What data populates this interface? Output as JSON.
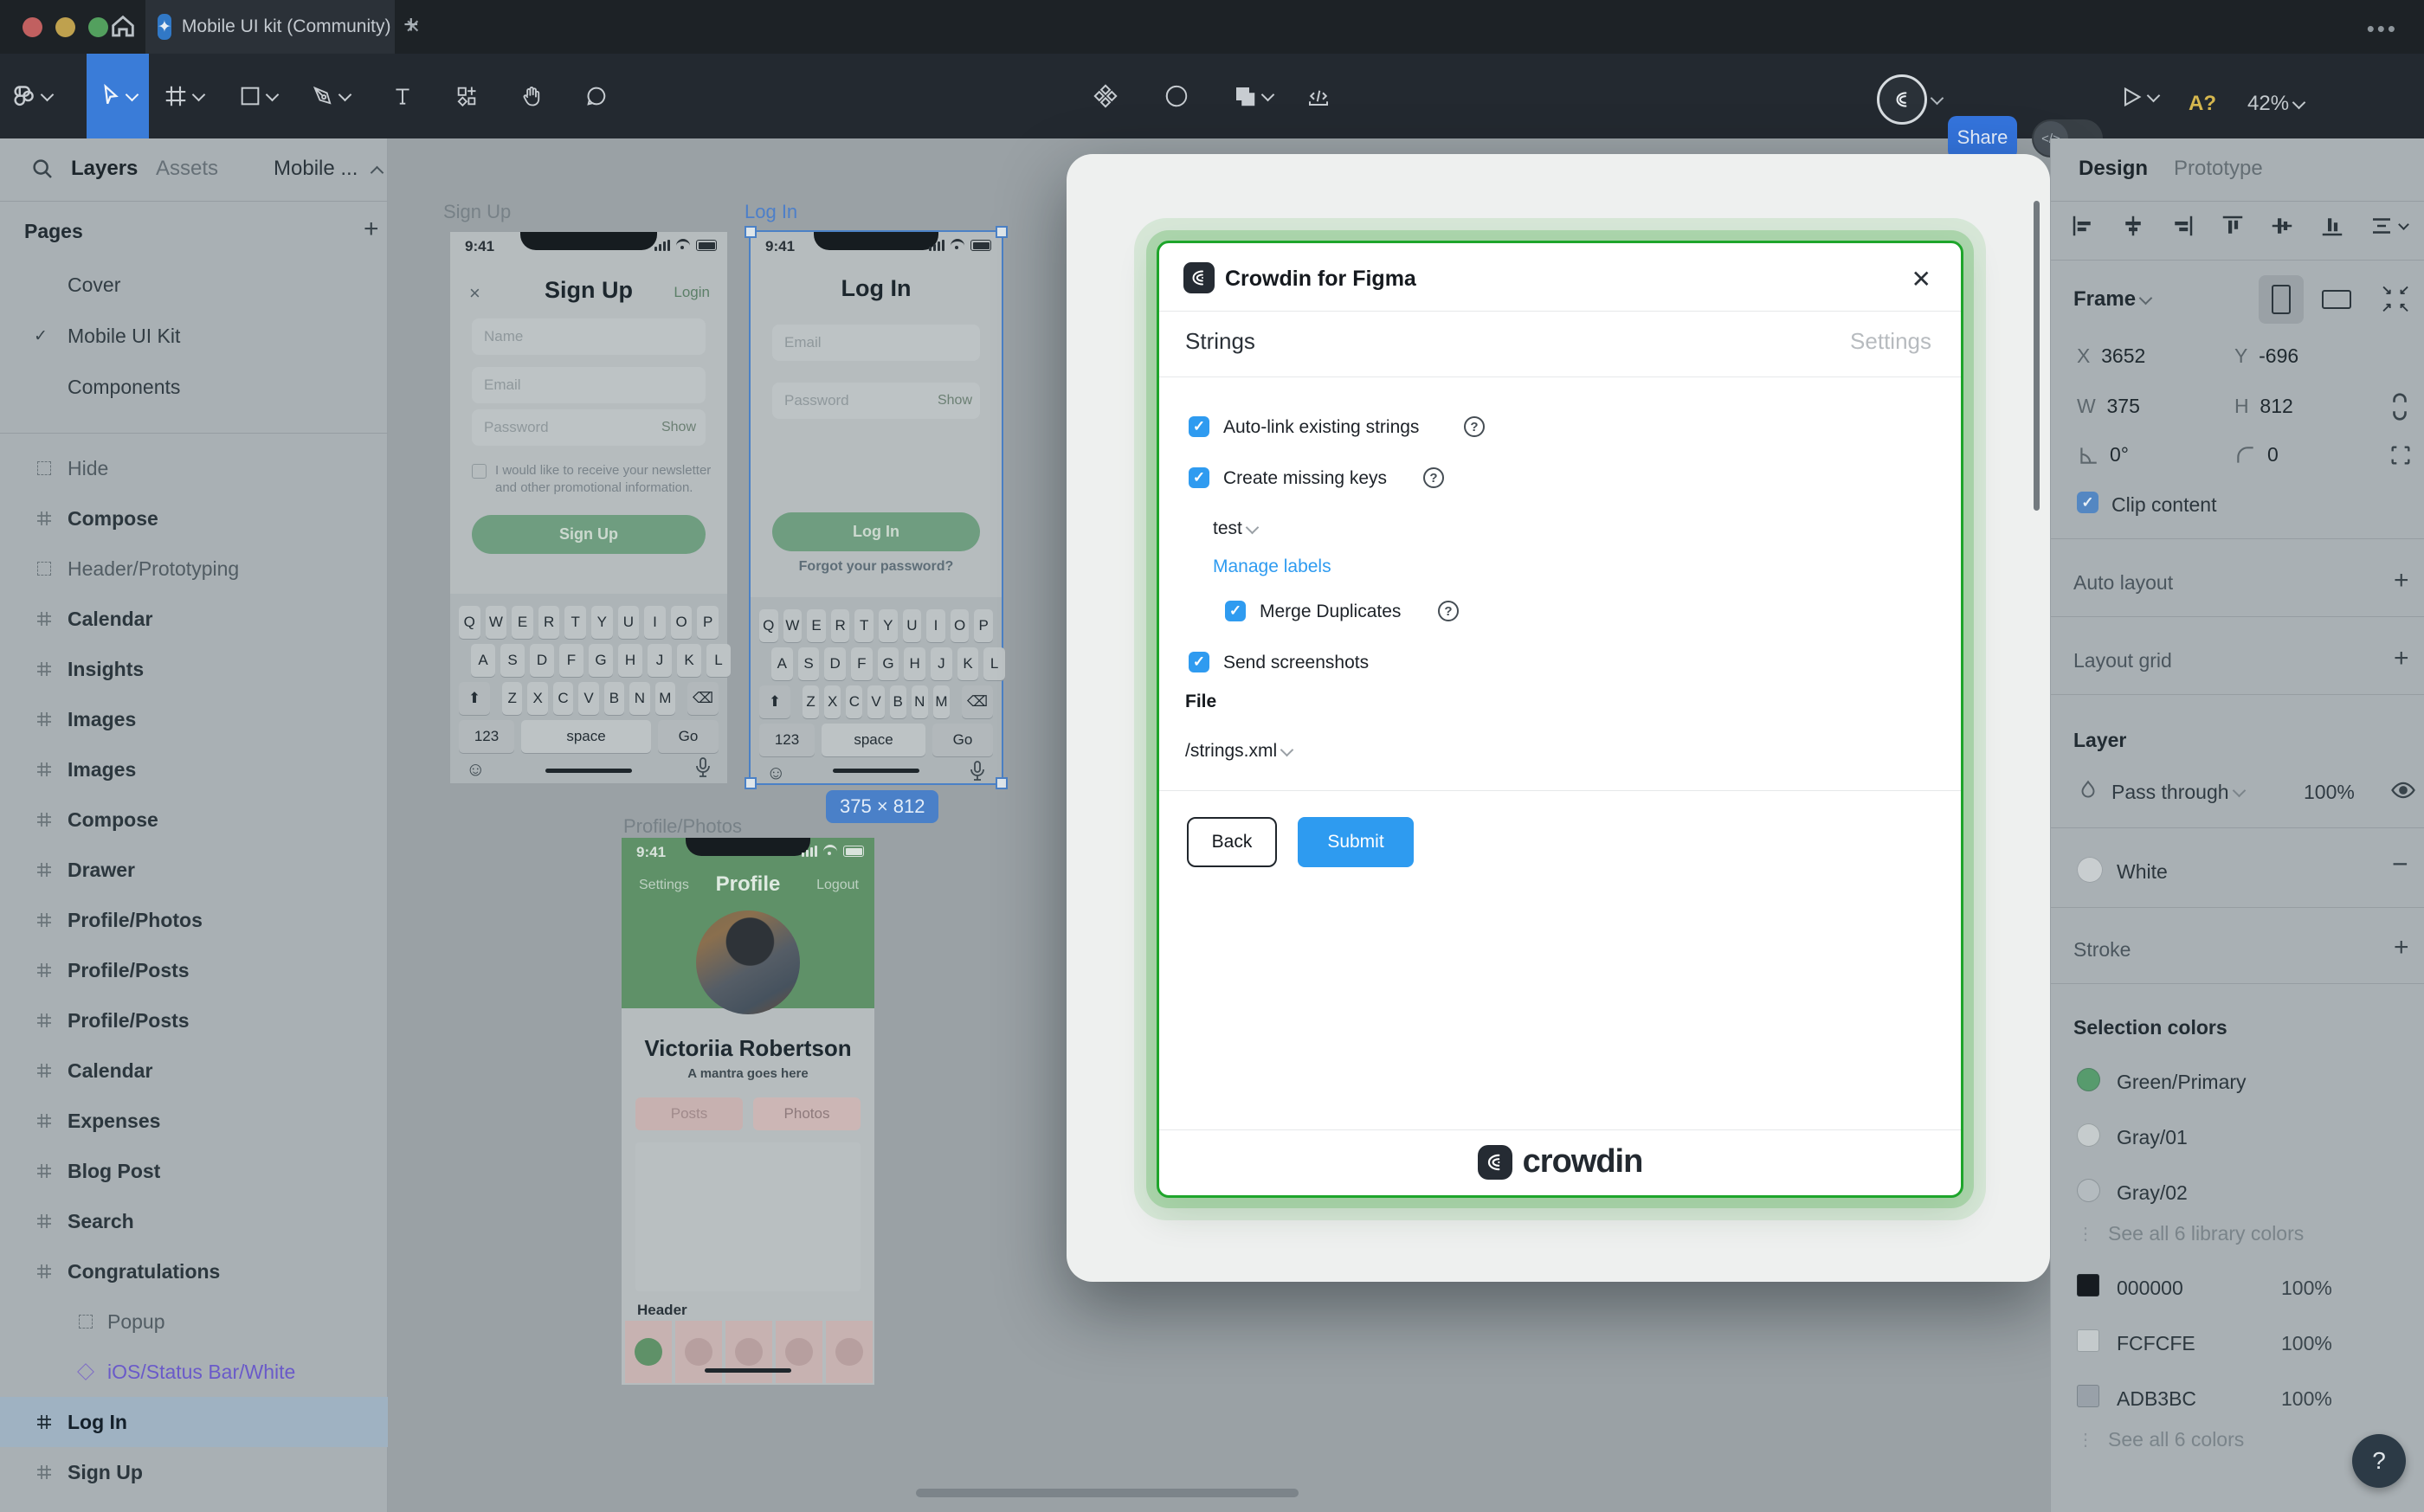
{
  "window": {
    "tab_title": "Mobile UI kit (Community)",
    "share_label": "Share",
    "a_badge": "A?",
    "zoom_level": "42%"
  },
  "left_sidebar": {
    "tabs": {
      "layers": "Layers",
      "assets": "Assets",
      "file": "Mobile ..."
    },
    "pages_header": "Pages",
    "pages": [
      {
        "label": "Cover",
        "checked": false
      },
      {
        "label": "Mobile UI Kit",
        "checked": true
      },
      {
        "label": "Components",
        "checked": false
      }
    ],
    "layers": [
      {
        "label": "Hide",
        "icon": "dashed-frame-icon",
        "indent": false,
        "purple": false,
        "selected": false
      },
      {
        "label": "Compose",
        "icon": "frame-icon",
        "indent": false,
        "purple": false,
        "selected": false
      },
      {
        "label": "Header/Prototyping",
        "icon": "dashed-frame-icon",
        "indent": false,
        "purple": false,
        "selected": false
      },
      {
        "label": "Calendar",
        "icon": "frame-icon",
        "indent": false,
        "purple": false,
        "selected": false
      },
      {
        "label": "Insights",
        "icon": "frame-icon",
        "indent": false,
        "purple": false,
        "selected": false
      },
      {
        "label": "Images",
        "icon": "frame-icon",
        "indent": false,
        "purple": false,
        "selected": false
      },
      {
        "label": "Images",
        "icon": "frame-icon",
        "indent": false,
        "purple": false,
        "selected": false
      },
      {
        "label": "Compose",
        "icon": "frame-icon",
        "indent": false,
        "purple": false,
        "selected": false
      },
      {
        "label": "Drawer",
        "icon": "frame-icon",
        "indent": false,
        "purple": false,
        "selected": false
      },
      {
        "label": "Profile/Photos",
        "icon": "frame-icon",
        "indent": false,
        "purple": false,
        "selected": false
      },
      {
        "label": "Profile/Posts",
        "icon": "frame-icon",
        "indent": false,
        "purple": false,
        "selected": false
      },
      {
        "label": "Profile/Posts",
        "icon": "frame-icon",
        "indent": false,
        "purple": false,
        "selected": false
      },
      {
        "label": "Calendar",
        "icon": "frame-icon",
        "indent": false,
        "purple": false,
        "selected": false
      },
      {
        "label": "Expenses",
        "icon": "frame-icon",
        "indent": false,
        "purple": false,
        "selected": false
      },
      {
        "label": "Blog Post",
        "icon": "frame-icon",
        "indent": false,
        "purple": false,
        "selected": false
      },
      {
        "label": "Search",
        "icon": "frame-icon",
        "indent": false,
        "purple": false,
        "selected": false
      },
      {
        "label": "Congratulations",
        "icon": "frame-icon",
        "indent": false,
        "purple": false,
        "selected": false
      },
      {
        "label": "Popup",
        "icon": "dashed-frame-icon",
        "indent": true,
        "purple": false,
        "selected": false
      },
      {
        "label": "iOS/Status Bar/White",
        "icon": "component-icon",
        "indent": true,
        "purple": true,
        "selected": false
      },
      {
        "label": "Log In",
        "icon": "frame-icon",
        "indent": false,
        "purple": false,
        "selected": true
      },
      {
        "label": "Sign Up",
        "icon": "frame-icon",
        "indent": false,
        "purple": false,
        "selected": false
      }
    ]
  },
  "canvas": {
    "sign_up": {
      "frame_label": "Sign Up",
      "time": "9:41",
      "close": "×",
      "title": "Sign Up",
      "login_link": "Login",
      "fields": [
        "Name",
        "Email",
        "Password"
      ],
      "show": "Show",
      "newsletter": "I would like to receive your newsletter and other promotional information.",
      "button": "Sign Up"
    },
    "log_in": {
      "frame_label": "Log In",
      "time": "9:41",
      "title": "Log In",
      "fields": [
        "Email",
        "Password"
      ],
      "show": "Show",
      "button": "Log In",
      "forgot": "Forgot your password?",
      "size_badge": "375 × 812"
    },
    "profile": {
      "frame_label": "Profile/Photos",
      "time": "9:41",
      "nav_left": "Settings",
      "title": "Profile",
      "nav_right": "Logout",
      "name": "Victoriia Robertson",
      "mantra": "A mantra goes here",
      "tabs": [
        "Posts",
        "Photos"
      ],
      "header_label": "Header"
    },
    "keyboard": {
      "row1": [
        "Q",
        "W",
        "E",
        "R",
        "T",
        "Y",
        "U",
        "I",
        "O",
        "P"
      ],
      "row2": [
        "A",
        "S",
        "D",
        "F",
        "G",
        "H",
        "J",
        "K",
        "L"
      ],
      "row3": [
        "Z",
        "X",
        "C",
        "V",
        "B",
        "N",
        "M"
      ],
      "num": "123",
      "space": "space",
      "go": "Go"
    }
  },
  "dialog": {
    "app_title": "Crowdin for Figma",
    "close": "✕",
    "tab_strings": "Strings",
    "tab_settings": "Settings",
    "checkbox_autolink": "Auto-link existing strings",
    "checkbox_create_keys": "Create missing keys",
    "label_dropdown": "test",
    "manage_labels": "Manage labels",
    "checkbox_merge": "Merge Duplicates",
    "checkbox_screenshots": "Send screenshots",
    "file_label": "File",
    "file_value": "/strings.xml",
    "back": "Back",
    "submit": "Submit",
    "brand": "crowdin"
  },
  "right_panel": {
    "tabs": {
      "design": "Design",
      "prototype": "Prototype"
    },
    "frame": {
      "title": "Frame",
      "x_label": "X",
      "x": "3652",
      "y_label": "Y",
      "y": "-696",
      "w_label": "W",
      "w": "375",
      "h_label": "H",
      "h": "812",
      "rotation": "0°",
      "radius": "0",
      "clip": "Clip content"
    },
    "sections": {
      "auto_layout": "Auto layout",
      "layout_grid": "Layout grid",
      "layer": "Layer",
      "blend_mode": "Pass through",
      "opacity": "100%",
      "fill_name": "White",
      "stroke": "Stroke",
      "selection_colors": "Selection colors",
      "see_library": "See all 6 library colors",
      "see_colors": "See all 6 colors",
      "help": "?"
    },
    "library_colors": [
      {
        "name": "Green/Primary",
        "color": "#579b6d"
      },
      {
        "name": "Gray/01",
        "color": "#c6cccd"
      },
      {
        "name": "Gray/02",
        "color": "#b4bbbf"
      }
    ],
    "hex_colors": [
      {
        "hex": "000000",
        "opacity": "100%",
        "color": "#161b20"
      },
      {
        "hex": "FCFCFE",
        "opacity": "100%",
        "color": "#c4cacc"
      },
      {
        "hex": "ADB3BC",
        "opacity": "100%",
        "color": "#99a1a9"
      }
    ]
  },
  "colors": {
    "accent_blue": "#3a7cd8",
    "dialog_green": "#1ea52b",
    "checkbox_blue": "#2f9bf0",
    "selection_blue": "#4b81c6",
    "badge_blue": "#4a80c8"
  }
}
